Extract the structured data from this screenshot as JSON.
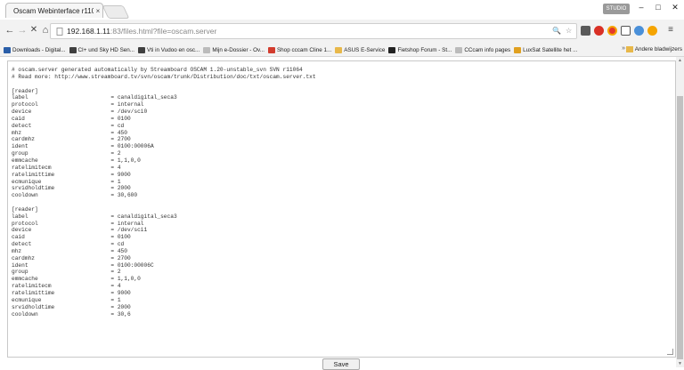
{
  "browser": {
    "tab_title": "Oscam Webinterface r110",
    "tab_close": "×",
    "profile_badge": "STUDIO",
    "window_controls": {
      "minimize": "–",
      "maximize": "□",
      "close": "✕"
    },
    "nav": {
      "back": "←",
      "forward": "→",
      "reload": "✕",
      "home": "⌂"
    },
    "url_host": "192.168.1.11",
    "url_rest": ":83/files.html?file=oscam.server",
    "bookmarks": [
      {
        "label": "Downloads - Digital...",
        "icon": "bookmark-icon",
        "color": "#2a5ea8"
      },
      {
        "label": "CI+ und Sky HD Sen...",
        "icon": "bookmark-icon",
        "color": "#3f3f3f"
      },
      {
        "label": "Vti in Vudoo en osc...",
        "icon": "bookmark-icon",
        "color": "#3f3f3f"
      },
      {
        "label": "Mijn e-Dossier - Ov...",
        "icon": "page-icon",
        "color": "#bbbbbb"
      },
      {
        "label": "Shop cccam Cline 1...",
        "icon": "bookmark-icon",
        "color": "#d23c2e"
      },
      {
        "label": "ASUS E-Service",
        "icon": "folder-icon",
        "color": "#e8b84a"
      },
      {
        "label": "Fietshop Forum - St...",
        "icon": "bookmark-icon",
        "color": "#222222"
      },
      {
        "label": "CCcam info pages",
        "icon": "page-icon",
        "color": "#bbbbbb"
      },
      {
        "label": "LuxSat Satellite het ...",
        "icon": "bookmark-icon",
        "color": "#e0a020"
      }
    ],
    "bookmarks_more": "»",
    "other_bookmarks": "Andere bladwijzers"
  },
  "editor": {
    "lines": [
      "# oscam.server generated automatically by Streamboard OSCAM 1.20-unstable_svn SVN r11064",
      "# Read more: http://www.streamboard.tv/svn/oscam/trunk/Distribution/doc/txt/oscam.server.txt",
      "",
      "[reader]",
      "label                         = canaldigital_seca3",
      "protocol                      = internal",
      "device                        = /dev/sci0",
      "caid                          = 0100",
      "detect                        = cd",
      "mhz                           = 450",
      "cardmhz                       = 2700",
      "ident                         = 0100:00006A",
      "group                         = 2",
      "emmcache                      = 1,1,0,0",
      "ratelimitecm                  = 4",
      "ratelimittime                 = 9000",
      "ecmunique                     = 1",
      "srvidholdtime                 = 2000",
      "cooldown                      = 30,600",
      "",
      "[reader]",
      "label                         = canaldigital_seca3",
      "protocol                      = internal",
      "device                        = /dev/sci1",
      "caid                          = 0100",
      "detect                        = cd",
      "mhz                           = 450",
      "cardmhz                       = 2700",
      "ident                         = 0100:00006C",
      "group                         = 2",
      "emmcache                      = 1,1,0,0",
      "ratelimitecm                  = 4",
      "ratelimittime                 = 9000",
      "ecmunique                     = 1",
      "srvidholdtime                 = 2000",
      "cooldown                      = 30,6"
    ],
    "save_label": "Save"
  }
}
